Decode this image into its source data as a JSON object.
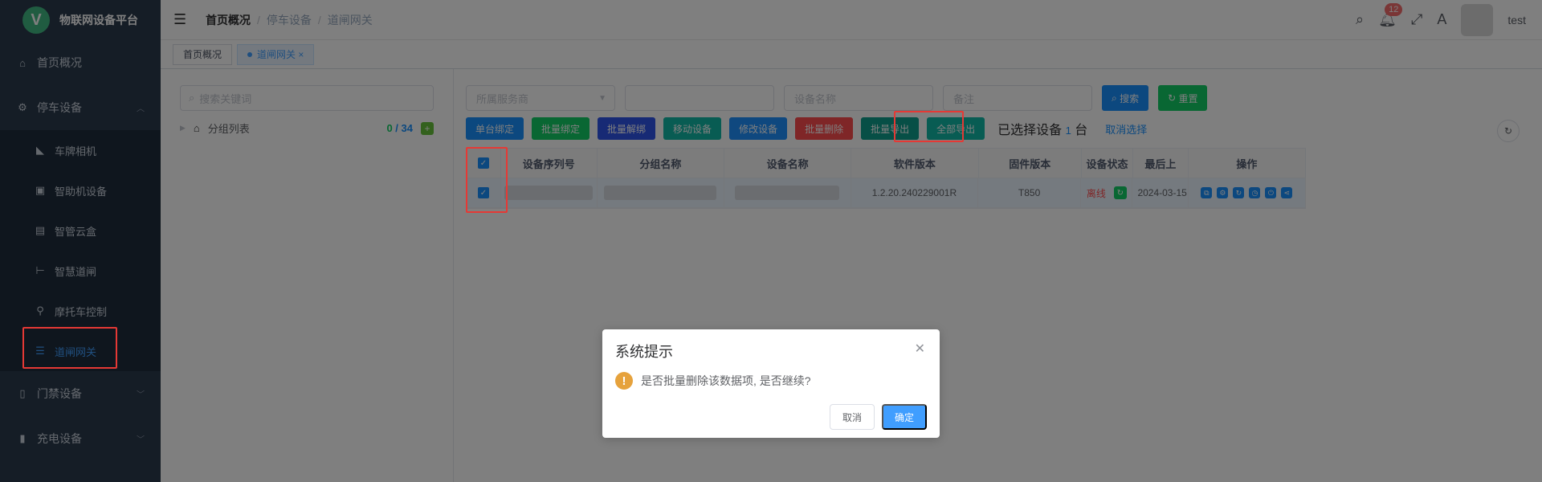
{
  "app": {
    "logo_letter": "V",
    "title": "物联网设备平台"
  },
  "sidebar": {
    "items": [
      {
        "label": "首页概况",
        "icon": "home-icon"
      },
      {
        "label": "停车设备",
        "icon": "parking-icon"
      },
      {
        "label": "车牌相机",
        "icon": "camera-icon"
      },
      {
        "label": "智助机设备",
        "icon": "kiosk-icon"
      },
      {
        "label": "智管云盒",
        "icon": "cloud-box-icon"
      },
      {
        "label": "智慧道闸",
        "icon": "barrier-icon"
      },
      {
        "label": "摩托车控制",
        "icon": "motorcycle-icon"
      },
      {
        "label": "道闸网关",
        "icon": "gateway-icon"
      },
      {
        "label": "门禁设备",
        "icon": "door-icon"
      },
      {
        "label": "充电设备",
        "icon": "charge-icon"
      }
    ]
  },
  "header": {
    "breadcrumb": [
      "首页概况",
      "停车设备",
      "道闸网关"
    ],
    "notification_count": "12",
    "user": "test"
  },
  "tags": [
    "首页概况",
    "道闸网关"
  ],
  "left_panel": {
    "search_placeholder": "搜索关键词",
    "tree_root": "分组列表",
    "count_online": "0",
    "count_sep": " / ",
    "count_total": "34"
  },
  "filters": {
    "service_provider": "所属服务商",
    "device_name": "设备名称",
    "remark": "备注",
    "search_btn": "搜索",
    "reset_btn": "重置"
  },
  "toolbar": {
    "buttons": [
      "单台绑定",
      "批量绑定",
      "批量解绑",
      "移动设备",
      "修改设备",
      "批量删除",
      "批量导出",
      "全部导出"
    ],
    "selected_label": "已选择设备",
    "selected_count": "1",
    "selected_unit": "台",
    "cancel_selection": "取消选择"
  },
  "table": {
    "columns": [
      "设备序列号",
      "分组名称",
      "设备名称",
      "软件版本",
      "固件版本",
      "设备状态",
      "最后上",
      "操作"
    ],
    "row": {
      "software": "1.2.20.240229001R",
      "firmware": "T850",
      "status": "离线",
      "last_online": "2024-03-15"
    }
  },
  "dialog": {
    "title": "系统提示",
    "message": "是否批量删除该数据项, 是否继续?",
    "cancel": "取消",
    "confirm": "确定"
  },
  "colors": {
    "sidebar_bg": "#2b3a4d",
    "primary": "#1890ff",
    "danger": "#ff4d4f",
    "highlight": "#e53935"
  }
}
